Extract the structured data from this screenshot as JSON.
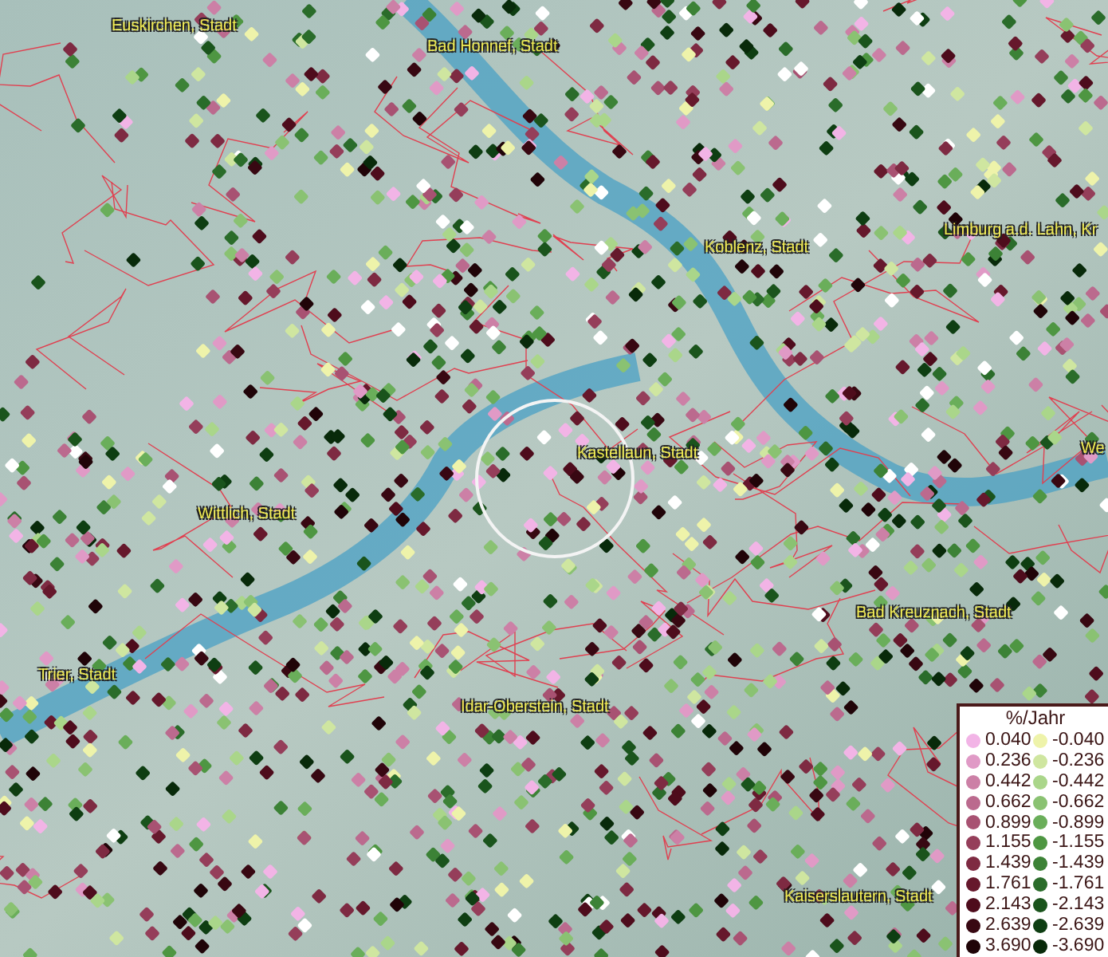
{
  "map": {
    "place_labels": [
      {
        "text": "Euskirchen, Stadt"
      },
      {
        "text": "Bad Honnef, Stadt"
      },
      {
        "text": "Koblenz, Stadt"
      },
      {
        "text": "Limburg a.d. Lahn, Kr"
      },
      {
        "text": "Kastellaun, Stadt"
      },
      {
        "text": "We"
      },
      {
        "text": "Wittlich, Stadt"
      },
      {
        "text": "Bad Kreuznach, Stadt"
      },
      {
        "text": "Trier, Stadt"
      },
      {
        "text": "Idar-Oberstein, Stadt"
      },
      {
        "text": "Kaiserslautern, Stadt"
      }
    ]
  },
  "legend": {
    "title": "%/Jahr",
    "positive": [
      {
        "label": "0.040",
        "color": "#f2b4e6"
      },
      {
        "label": "0.236",
        "color": "#e09ac6"
      },
      {
        "label": "0.442",
        "color": "#cc80a6"
      },
      {
        "label": "0.662",
        "color": "#bb6a8e"
      },
      {
        "label": "0.899",
        "color": "#a85272"
      },
      {
        "label": "1.155",
        "color": "#953e5a"
      },
      {
        "label": "1.439",
        "color": "#7e2a42"
      },
      {
        "label": "1.761",
        "color": "#66182c"
      },
      {
        "label": "2.143",
        "color": "#4e0c1c"
      },
      {
        "label": "2.639",
        "color": "#380812"
      },
      {
        "label": "3.690",
        "color": "#200408"
      }
    ],
    "negative": [
      {
        "label": "-0.040",
        "color": "#eef3aa"
      },
      {
        "label": "-0.236",
        "color": "#cfe6a0"
      },
      {
        "label": "-0.442",
        "color": "#aad68a"
      },
      {
        "label": "-0.662",
        "color": "#8ac272"
      },
      {
        "label": "-0.899",
        "color": "#6aae5a"
      },
      {
        "label": "-1.155",
        "color": "#4e9642"
      },
      {
        "label": "-1.439",
        "color": "#3c8236"
      },
      {
        "label": "-1.761",
        "color": "#2a6c2a"
      },
      {
        "label": "-2.143",
        "color": "#1a541c"
      },
      {
        "label": "-2.639",
        "color": "#0e3e12"
      },
      {
        "label": "-3.690",
        "color": "#082a0a"
      }
    ]
  }
}
